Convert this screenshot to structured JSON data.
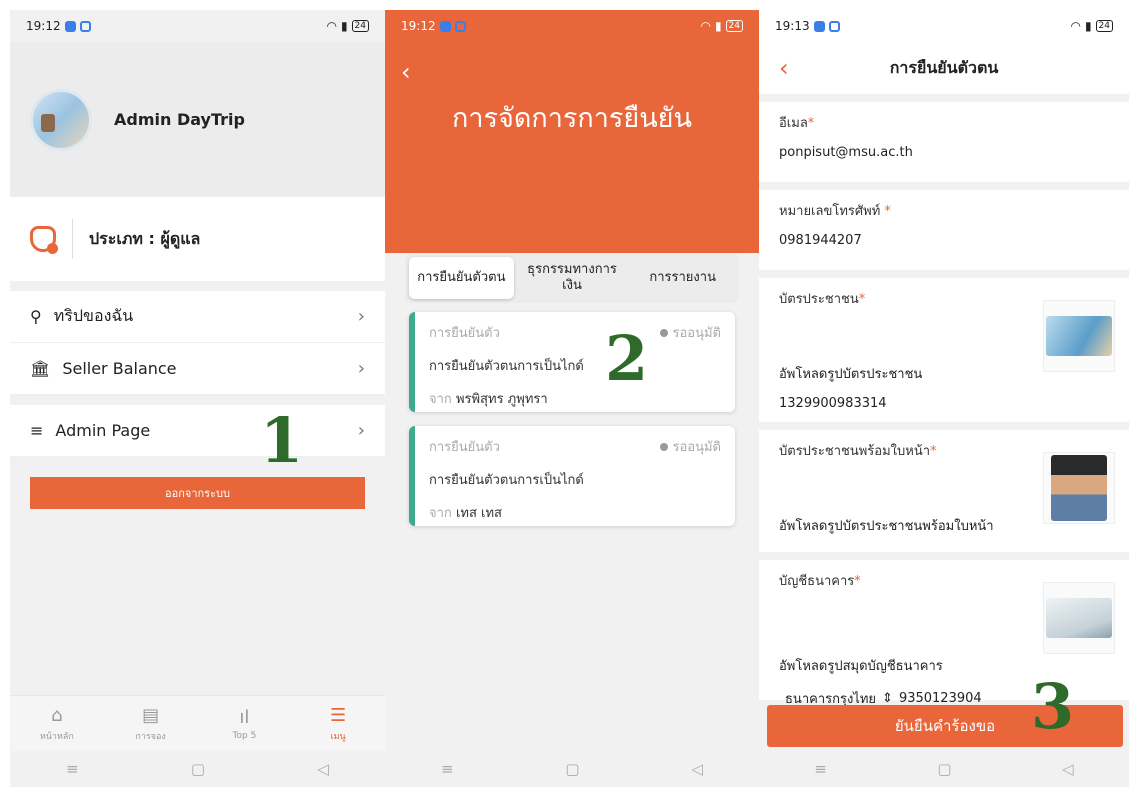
{
  "screen1": {
    "status": {
      "time": "19:12",
      "battery": "24"
    },
    "profile": {
      "name": "Admin DayTrip"
    },
    "role": {
      "text": "ประเภท : ผู้ดูแล"
    },
    "menu": [
      {
        "label": "ทริปของฉัน",
        "icon": "location-pin-icon"
      },
      {
        "label": "Seller Balance",
        "icon": "bank-icon"
      }
    ],
    "admin_page": {
      "label": "Admin Page",
      "icon": "list-edit-icon"
    },
    "logout": "ออกจากระบบ",
    "tabs": [
      {
        "label": "หน้าหลัก",
        "icon": "home-icon"
      },
      {
        "label": "การจอง",
        "icon": "receipt-icon"
      },
      {
        "label": "Top 5",
        "icon": "bar-chart-icon"
      },
      {
        "label": "เมนู",
        "icon": "menu-icon"
      }
    ],
    "step": "1"
  },
  "screen2": {
    "status": {
      "time": "19:12",
      "battery": "24"
    },
    "title": "การจัดการการยืนยัน",
    "segments": [
      "การยืนยันตัวตน",
      "ธุรกรรมทางการเงิน",
      "การรายงาน"
    ],
    "cards": [
      {
        "type": "การยืนยันตัว",
        "status": "รออนุมัติ",
        "title": "การยืนยันตัวตนการเป็นไกด์",
        "from_prefix": "จาก",
        "from": "พรพิสุทร ภูพุทรา"
      },
      {
        "type": "การยืนยันตัว",
        "status": "รออนุมัติ",
        "title": "การยืนยันตัวตนการเป็นไกด์",
        "from_prefix": "จาก",
        "from": "เทส เทส"
      }
    ],
    "step": "2"
  },
  "screen3": {
    "status": {
      "time": "19:13",
      "battery": "24"
    },
    "title": "การยืนยันตัวตน",
    "email": {
      "label": "อีเมล",
      "value": "ponpisut@msu.ac.th"
    },
    "phone": {
      "label": "หมายเลขโทรศัพท์ ",
      "value": "0981944207"
    },
    "id_card": {
      "label": "บัตรประชาชน",
      "upload": "อัพโหลดรูปบัตรประชาชน",
      "value": "1329900983314"
    },
    "id_face": {
      "label": "บัตรประชาชนพร้อมใบหน้า",
      "upload": "อัพโหลดรูปบัตรประชาชนพร้อมใบหน้า"
    },
    "bank": {
      "label": "บัญชีธนาคาร",
      "upload": "อัพโหลดรูปสมุดบัญชีธนาคาร",
      "bank_name": "ธนาคารกรุงไทย",
      "account": "9350123904"
    },
    "required_mark": "*",
    "confirm": "ยันยืนคำร้องขอ",
    "step": "3"
  },
  "colors": {
    "accent": "#e8663a",
    "card_border": "#3faa8f",
    "step_number": "#2e6b2a"
  }
}
